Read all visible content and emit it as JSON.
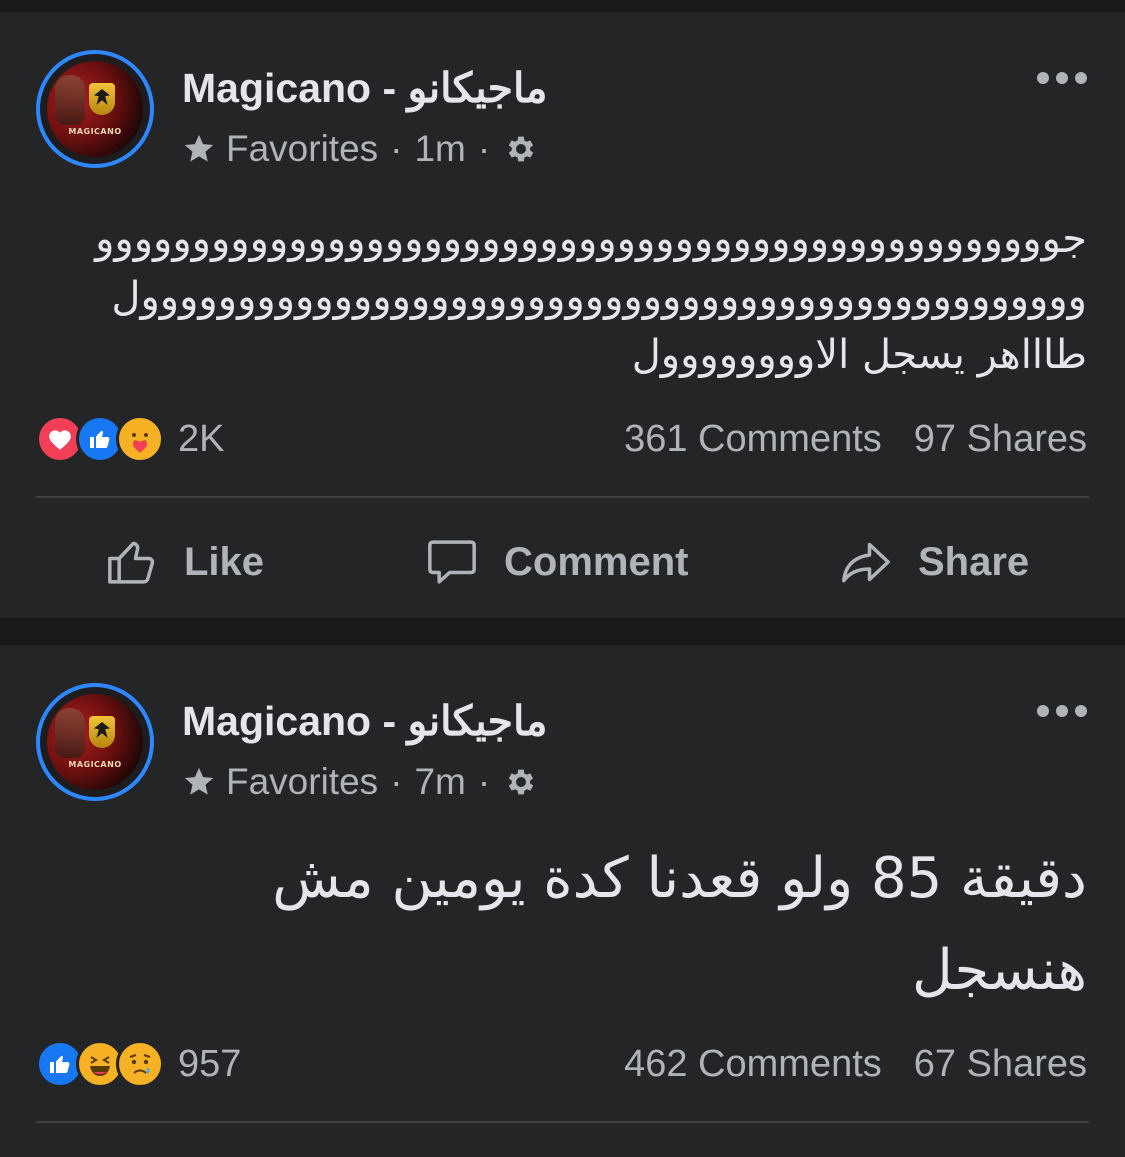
{
  "posts": [
    {
      "author": "Magicano - ماجيكانو",
      "avatar_text": "MAGICANO",
      "audience": "Favorites",
      "time": "1m",
      "text_lines": [
        "جوووووووووووووووووووووووووووووووووووووووووووووووووو",
        "ووووووووووووووووووووووووووووووووووووووووووووووووول",
        "طاااهر يسجل الاوووووووول"
      ],
      "reactions": [
        "love",
        "like",
        "care"
      ],
      "reaction_count": "2K",
      "comments": "361 Comments",
      "shares": "97 Shares",
      "actions": {
        "like": "Like",
        "comment": "Comment",
        "share": "Share"
      }
    },
    {
      "author": "Magicano - ماجيكانو",
      "avatar_text": "MAGICANO",
      "audience": "Favorites",
      "time": "7m",
      "text": "دقيقة 85 ولو قعدنا كدة يومين مش هنسجل",
      "reactions": [
        "like",
        "haha",
        "sad"
      ],
      "reaction_count": "957",
      "comments": "462 Comments",
      "shares": "67 Shares"
    }
  ],
  "colors": {
    "background": "#18191a",
    "card": "#242526",
    "text_primary": "#e4e6eb",
    "text_secondary": "#b0b3b8",
    "accent_blue": "#2d88ff",
    "love_red": "#f33e58",
    "reaction_yellow": "#f7b125"
  }
}
